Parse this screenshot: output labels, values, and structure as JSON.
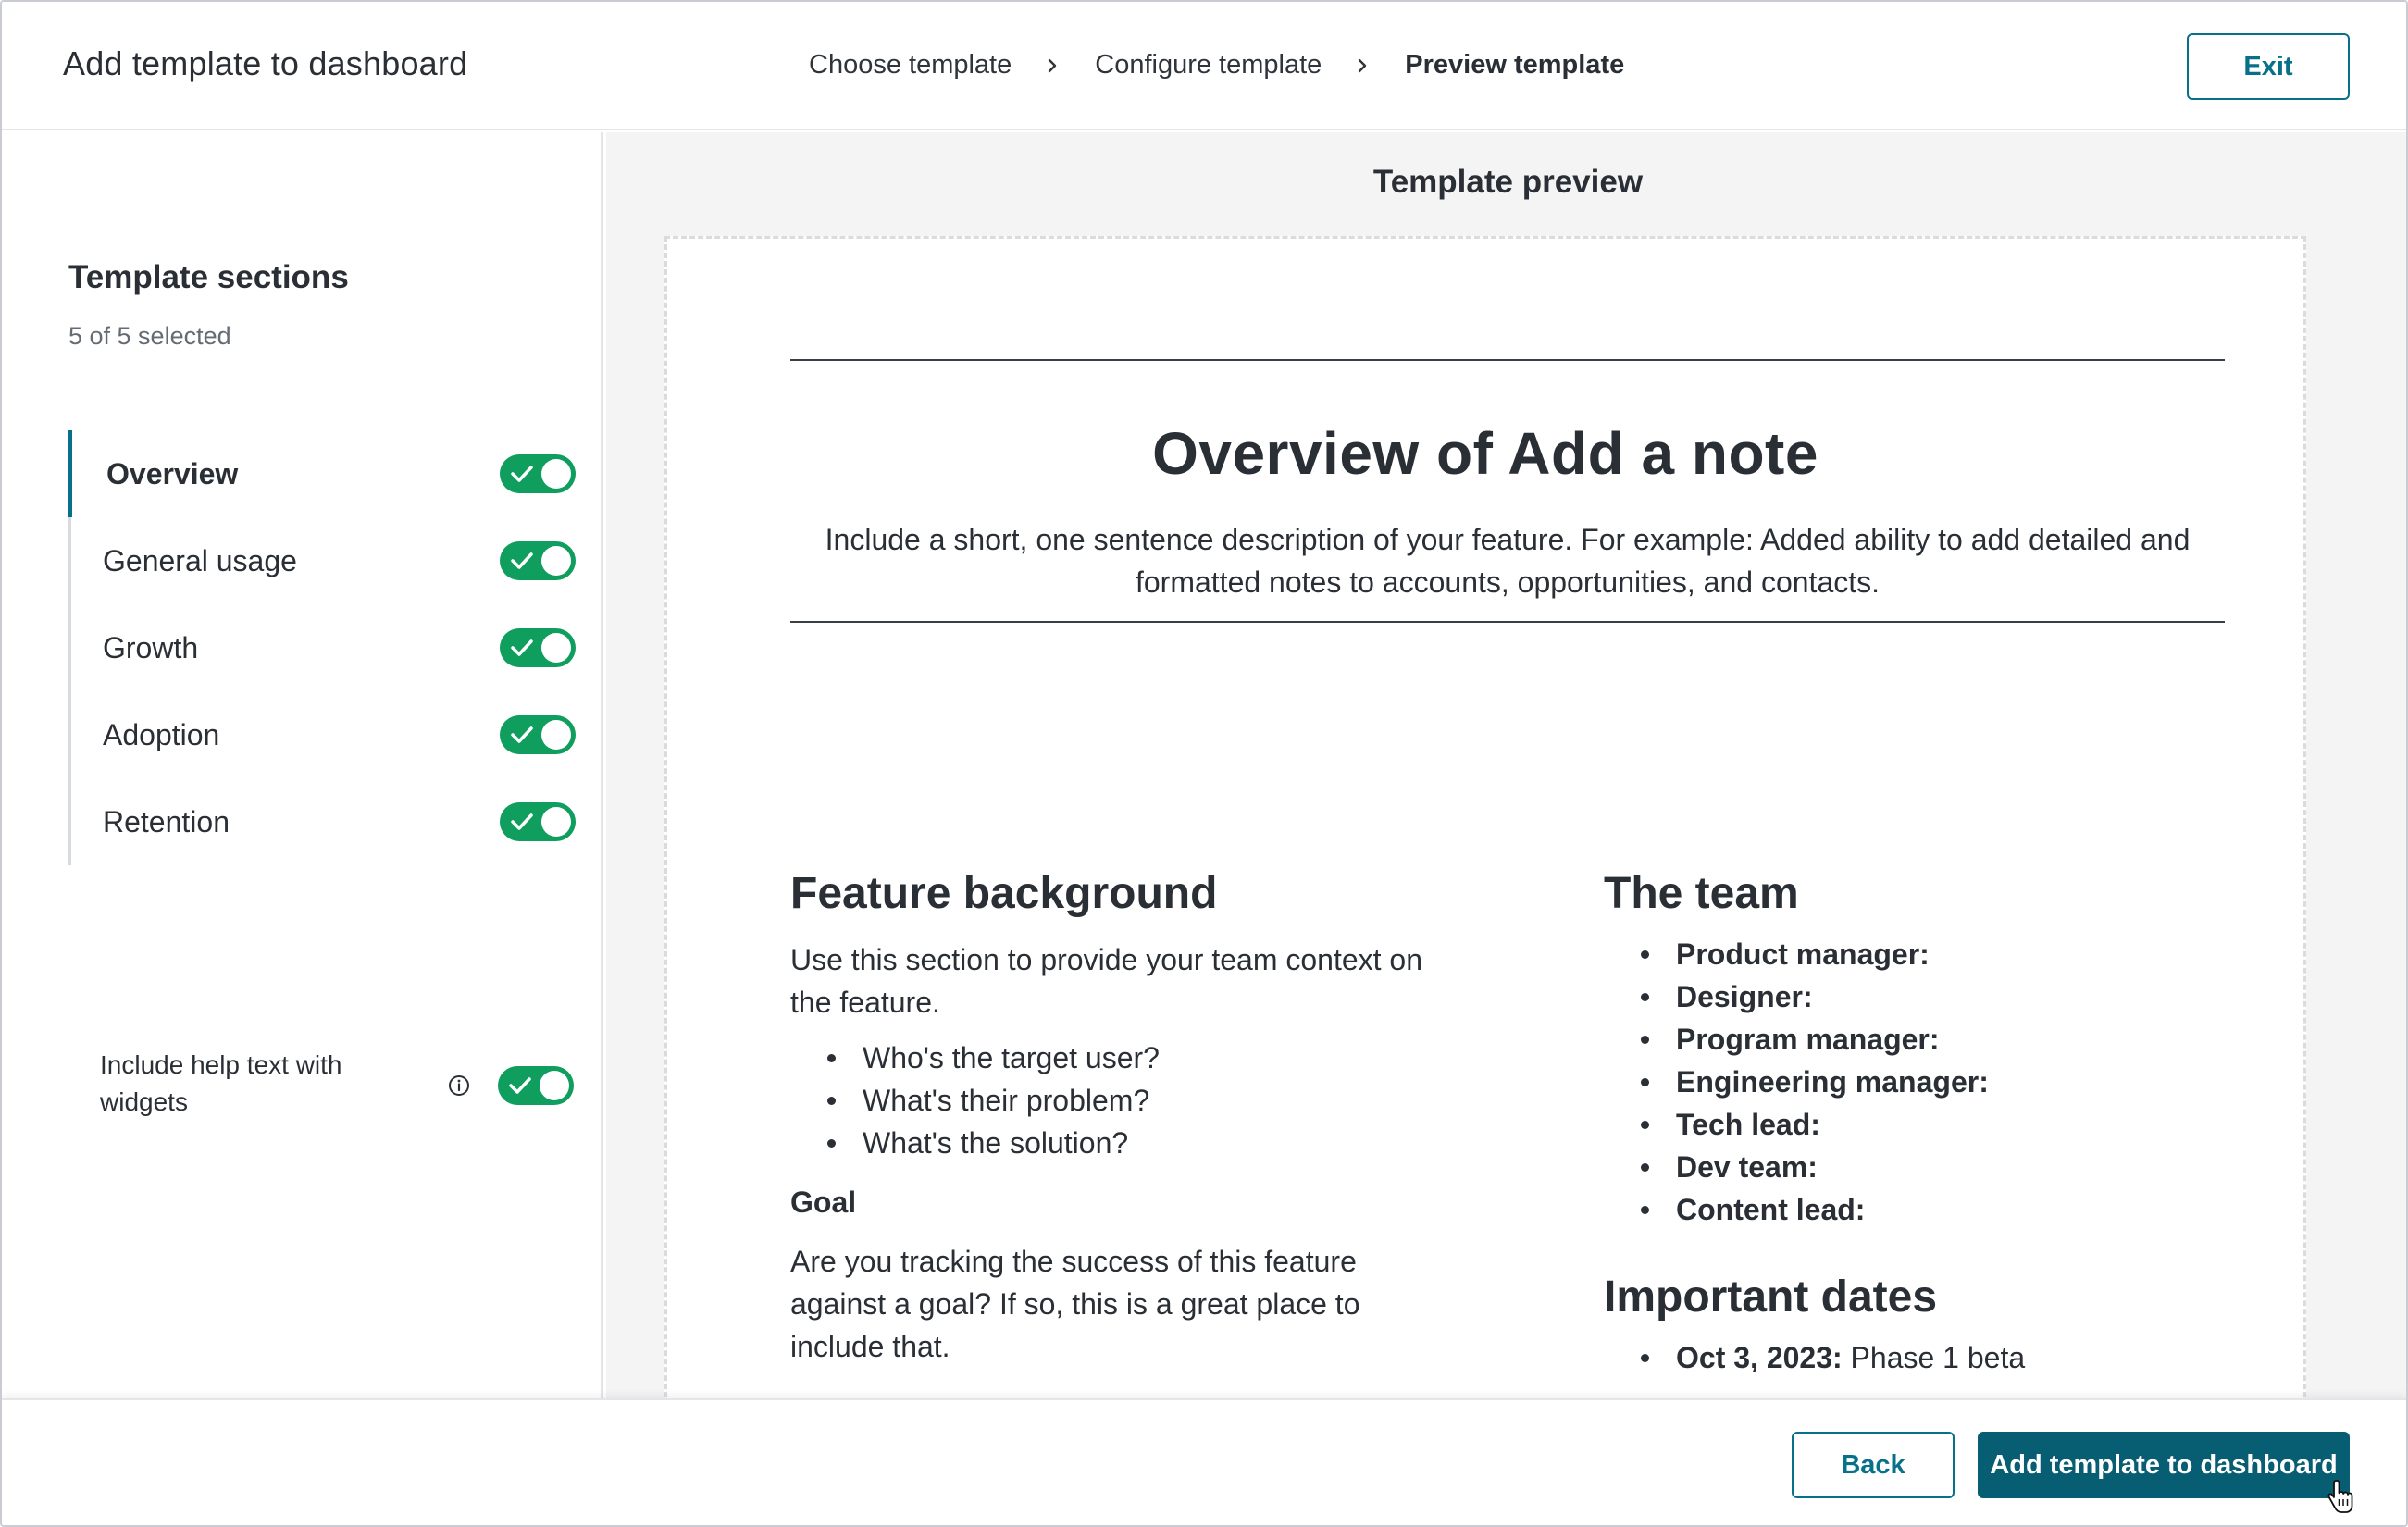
{
  "header": {
    "title": "Add template to dashboard",
    "steps": [
      "Choose template",
      "Configure template",
      "Preview template"
    ],
    "exit_label": "Exit"
  },
  "sidebar": {
    "title": "Template sections",
    "count": "5 of 5 selected",
    "sections": [
      {
        "label": "Overview",
        "enabled": true,
        "active": true
      },
      {
        "label": "General usage",
        "enabled": true
      },
      {
        "label": "Growth",
        "enabled": true
      },
      {
        "label": "Adoption",
        "enabled": true
      },
      {
        "label": "Retention",
        "enabled": true
      }
    ],
    "help_text_label": "Include help text with widgets",
    "help_text_enabled": true
  },
  "preview": {
    "heading": "Template preview",
    "overview_title": "Overview of Add a note",
    "overview_desc": "Include a short, one sentence description of your feature. For example: Added ability to add detailed and formatted notes to accounts, opportunities, and contacts.",
    "feature_background": {
      "title": "Feature background",
      "intro": "Use this section to provide your team context on the feature.",
      "bullets": [
        "Who's the target user?",
        "What's their problem?",
        "What's the solution?"
      ],
      "goal_title": "Goal",
      "goal_text": "Are you tracking the success of this feature against a goal? If so, this is a great place to include that."
    },
    "team": {
      "title": "The team",
      "members": [
        "Product manager:",
        "Designer:",
        "Program manager:",
        "Engineering manager:",
        "Tech lead:",
        "Dev team:",
        "Content lead:"
      ]
    },
    "dates": {
      "title": "Important dates",
      "items": [
        {
          "date": "Oct 3, 2023:",
          "label": "Phase 1 beta"
        }
      ]
    }
  },
  "footer": {
    "back_label": "Back",
    "add_label": "Add template to dashboard"
  },
  "colors": {
    "accent": "#08718a",
    "primary_button": "#075e73",
    "toggle_on": "#0f9e5e"
  },
  "icons": [
    "chevron-right-icon",
    "check-icon",
    "info-icon",
    "hand-pointer-cursor-icon"
  ]
}
